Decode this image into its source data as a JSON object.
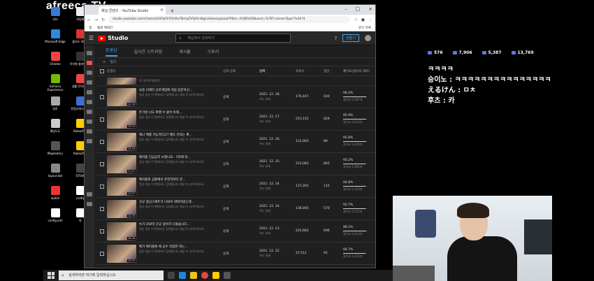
{
  "overlay": {
    "brand": "afreeca TV",
    "stats": [
      {
        "icon": "viewer-icon",
        "value": "576"
      },
      {
        "icon": "chat-icon",
        "value": "7,906"
      },
      {
        "icon": "up-icon",
        "value": "5,387"
      },
      {
        "icon": "fan-icon",
        "value": "13,769"
      }
    ],
    "chat": [
      {
        "nick": "",
        "message": "ㅋㅋㅋㅋ"
      },
      {
        "nick": "승이노",
        "message": "ㅋㅋㅋㅋㅋㅋㅋㅋㅋㅋㅋㅋㅋㅋㅋ"
      },
      {
        "nick": "えるけん",
        "message": "ㅁㅊ"
      },
      {
        "nick": "후츠",
        "message": "카"
      }
    ]
  },
  "desktop": {
    "icons": [
      "인터",
      "바탕화",
      "Microsoft Edge",
      "플러스 라디오",
      "Chrome",
      "이지쿼 클라이언트",
      "GeForce Experience",
      "생활 Chrome",
      "일로",
      "한컴오피스 뷰어",
      "해상도도",
      "KakaoTalk",
      "Maplestory",
      "KakaoTalk",
      "layout.dat",
      "STOVE",
      "watch",
      "config",
      "config.xml",
      "파"
    ]
  },
  "browser": {
    "tab_title": "채널 콘텐츠 - YouTube Studio",
    "url": "studio.youtube.com/channel/UCbFhYUHXvTBmaZVfyFa-Wg/videos/upload?filter=%5B%5D&sort=%7B\"columnType\"%3A\"d",
    "bookmarks": [
      "앱",
      "통합 캐릭터"
    ],
    "bookmarks_right": "읽기 목록"
  },
  "studio": {
    "logo": "Studio",
    "search_placeholder": "채널에서 검색하기",
    "create_label": "만들기",
    "tabs": [
      "동영상",
      "실시간 스트리밍",
      "게시물",
      "스토리"
    ],
    "filter_label": "필터",
    "columns": [
      "동영상",
      "공개 상태",
      "날짜",
      "조회수",
      "댓글",
      "좋아요(싫어요 대비)"
    ],
    "partial_row": "이 사이트에서도 ...",
    "visibility": "공개",
    "date_sub": "게시 날짜",
    "videos": [
      {
        "title": "요즘 디렉터 공포게임에 처음 입문하신...",
        "desc": "영상 영상 이 편에서도 검색합니다 채널 이 사이트에서도",
        "duration": "12:18",
        "date": "2021. 12. 28.",
        "views": "176,447",
        "comments": "430",
        "likes": "96.4%",
        "likes_sub": "좋아요 2,207개",
        "like_ratio": 0.964
      },
      {
        "title": "돈가방 나도 여행 수 없어 이제...",
        "desc": "영상 영상 이 편에서도 검색합니다 채널 이 사이트에서도",
        "duration": "15:03",
        "date": "2021. 12. 27.",
        "views": "253,155",
        "comments": "629",
        "likes": "95.9%",
        "likes_sub": "좋아요 3,223개",
        "like_ratio": 0.959
      },
      {
        "title": "에니 메를 가능하다고? 했도 안되는 확...",
        "desc": "영상 영상 이 편에서도 검색합니다 채널 이 사이트에서도",
        "duration": "10:44",
        "date": "2021. 12. 26.",
        "views": "131,903",
        "comments": "99",
        "likes": "95.8%",
        "likes_sub": "좋아요 1,839개",
        "like_ratio": 0.958
      },
      {
        "title": "메이플 긴급공지 보겠나요.. 1억에 처...",
        "desc": "영상 영상 이 편에서도 검색합니다 채널 이 사이트에서도",
        "duration": "11:21",
        "date": "2021. 12. 25.",
        "views": "223,083",
        "comments": "863",
        "likes": "95.2%",
        "likes_sub": "좋아요 1,465개",
        "like_ratio": 0.952
      },
      {
        "title": "메이플로 심판에서 흔한하려다 흔...",
        "desc": "영상 영상 이 편에서도 검색합니다 채널 이 사이트에서도",
        "duration": "13:07",
        "date": "2021. 12. 24.",
        "views": "137,262",
        "comments": "115",
        "likes": "94.8%",
        "likes_sub": "좋아요 2,110개",
        "like_ratio": 0.948
      },
      {
        "title": "신규 점심구세트가 나와서 대박이었는데...",
        "desc": "영상 영상 이 편에서도 검색합니다 채널 이 사이트에서도",
        "duration": "14:30",
        "date": "2021. 12. 24.",
        "views": "138,905",
        "comments": "570",
        "likes": "92.7%",
        "likes_sub": "좋아요 2,155개",
        "like_ratio": 0.927
      },
      {
        "title": "누가 250억 신규 장비가 나왔습니다...",
        "desc": "영상 영상 이 편에서도 검색합니다 채널 이 사이트에서도",
        "duration": "16:46",
        "date": "2021. 12. 23.",
        "views": "225,683",
        "comments": "696",
        "likes": "98.1%",
        "likes_sub": "좋아요 2,411개",
        "like_ratio": 0.981
      },
      {
        "title": "메가 메이플에 에 공수 작업한 하는...",
        "desc": "영상 영상 이 편에서도 검색합니다 채널 이 사이트에서도",
        "duration": "10:02",
        "date": "2021. 12. 22.",
        "views": "47,512",
        "comments": "91",
        "likes": "94.7%",
        "likes_sub": "좋아요 1,022개",
        "like_ratio": 0.947
      }
    ]
  },
  "taskbar": {
    "search_placeholder": "검색하려면 여기에 입력하십시오."
  }
}
